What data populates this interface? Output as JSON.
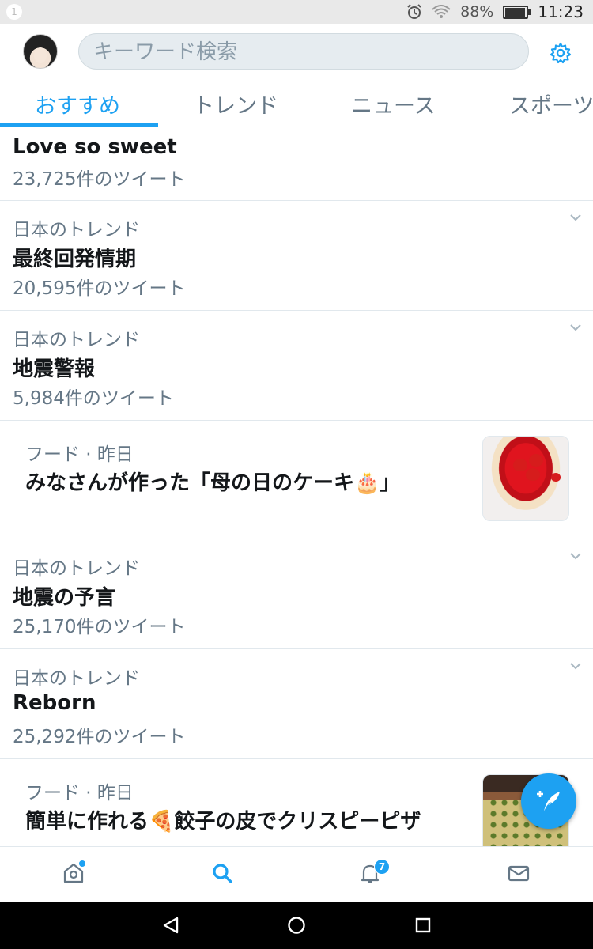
{
  "status_bar": {
    "notification_badge": "1",
    "battery": "88%",
    "battery_level": 0.88,
    "time": "11:23",
    "icons": [
      "alarm-icon",
      "wifi-icon",
      "battery-icon"
    ]
  },
  "header": {
    "search_placeholder": "キーワード検索",
    "settings_icon": "gear-icon"
  },
  "tabs": [
    {
      "label": "おすすめ",
      "active": true
    },
    {
      "label": "トレンド",
      "active": false
    },
    {
      "label": "ニュース",
      "active": false
    },
    {
      "label": "スポーツ",
      "active": false
    }
  ],
  "feed": [
    {
      "type": "trend",
      "context": "",
      "title": "Love so sweet",
      "count": "23,725件のツイート"
    },
    {
      "type": "trend",
      "context": "日本のトレンド",
      "title": "最終回発情期",
      "count": "20,595件のツイート"
    },
    {
      "type": "trend",
      "context": "日本のトレンド",
      "title": "地震警報",
      "count": "5,984件のツイート"
    },
    {
      "type": "story",
      "context": "フード · 昨日",
      "title": "みなさんが作った「母の日のケーキ🎂」",
      "thumbnail": "strawberry-cake-image"
    },
    {
      "type": "trend",
      "context": "日本のトレンド",
      "title": "地震の予言",
      "count": "25,170件のツイート"
    },
    {
      "type": "trend",
      "context": "日本のトレンド",
      "title": "Reborn",
      "count": "25,292件のツイート"
    },
    {
      "type": "story",
      "context": "フード · 昨日",
      "title": "簡単に作れる🍕餃子の皮でクリスピーピザ",
      "thumbnail": "pizza-image"
    }
  ],
  "fab": {
    "icon": "compose-tweet-icon"
  },
  "bottom_nav": {
    "items": [
      "home-icon",
      "search-icon",
      "notifications-icon",
      "messages-icon"
    ],
    "notifications_badge": "7",
    "active": "search"
  },
  "colors": {
    "accent": "#1da1f2",
    "text": "#14171a",
    "secondary_text": "#657786",
    "divider": "#e1e8ed"
  }
}
